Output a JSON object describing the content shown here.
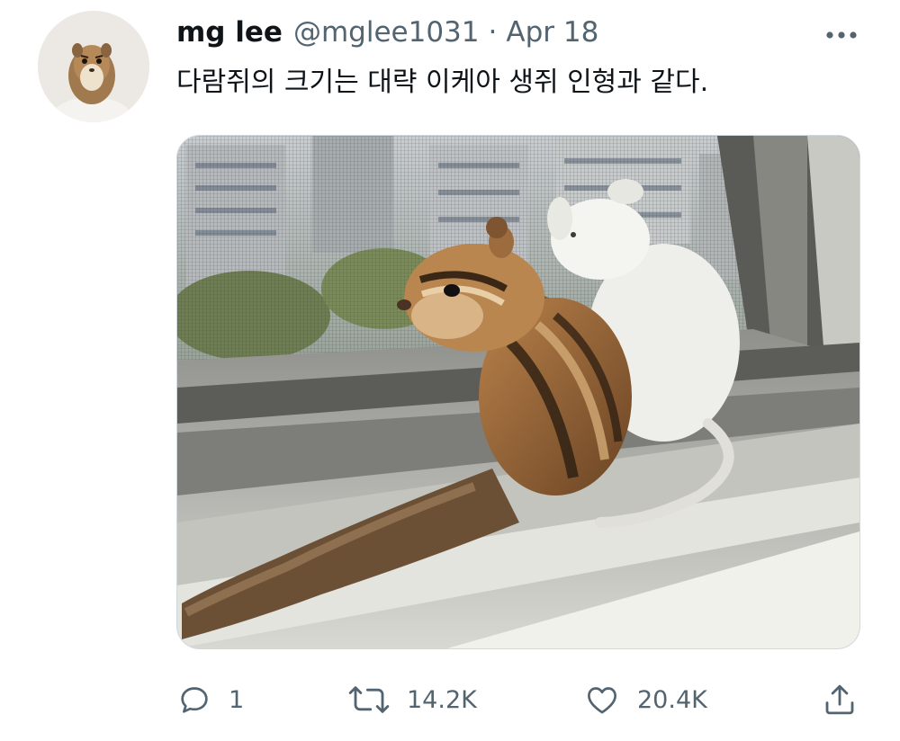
{
  "tweet": {
    "author_name": "mg lee",
    "author_handle": "@mglee1031",
    "separator": "·",
    "date": "Apr 18",
    "text": "다람쥐의 크기는 대략 이케아 생쥐 인형과 같다."
  },
  "icons": {
    "more": "more-horizontal-icon",
    "reply": "reply-bubble-icon",
    "retweet": "retweet-icon",
    "like": "heart-icon",
    "share": "share-upload-icon"
  },
  "actions": {
    "reply_count": "1",
    "retweet_count": "14.2K",
    "like_count": "20.4K"
  },
  "colors": {
    "text_primary": "#0f1419",
    "text_secondary": "#536471",
    "border": "#cfd9de"
  }
}
